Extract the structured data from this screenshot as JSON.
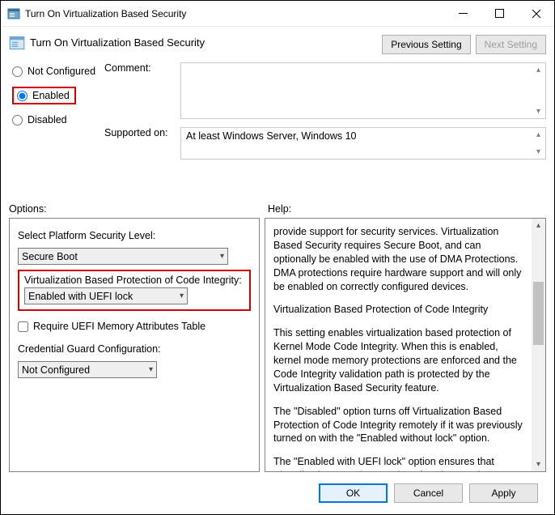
{
  "window": {
    "title": "Turn On Virtualization Based Security"
  },
  "header": {
    "title": "Turn On Virtualization Based Security",
    "prev": "Previous Setting",
    "next": "Next Setting"
  },
  "radios": {
    "not_configured": "Not Configured",
    "enabled": "Enabled",
    "disabled": "Disabled",
    "selected": "enabled"
  },
  "comment": {
    "label": "Comment:",
    "value": ""
  },
  "supported": {
    "label": "Supported on:",
    "value": "At least Windows Server, Windows 10"
  },
  "labels": {
    "options": "Options:",
    "help": "Help:"
  },
  "options": {
    "platform_label": "Select Platform Security Level:",
    "platform_value": "Secure Boot",
    "vbpci_label": "Virtualization Based Protection of Code Integrity:",
    "vbpci_value": "Enabled with UEFI lock",
    "require_uefi": "Require UEFI Memory Attributes Table",
    "cred_label": "Credential Guard Configuration:",
    "cred_value": "Not Configured"
  },
  "help": {
    "p1": "provide support for security services. Virtualization Based Security requires Secure Boot, and can optionally be enabled with the use of DMA Protections. DMA protections require hardware support and will only be enabled on correctly configured devices.",
    "p2": "Virtualization Based Protection of Code Integrity",
    "p3": "This setting enables virtualization based protection of Kernel Mode Code Integrity. When this is enabled, kernel mode memory protections are enforced and the Code Integrity validation path is protected by the Virtualization Based Security feature.",
    "p4": "The \"Disabled\" option turns off Virtualization Based Protection of Code Integrity remotely if it was previously turned on with the \"Enabled without lock\" option.",
    "p5": "The \"Enabled with UEFI lock\" option ensures that Virtualization Based Protection of Code Integrity cannot be disabled remotely. In order to disable the feature, you must set the Group Policy to"
  },
  "buttons": {
    "ok": "OK",
    "cancel": "Cancel",
    "apply": "Apply"
  }
}
